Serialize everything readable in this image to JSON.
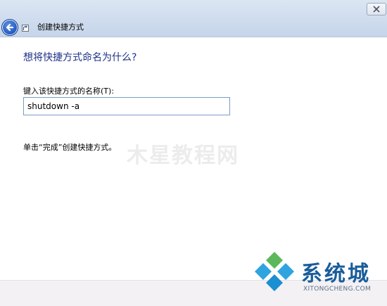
{
  "window": {
    "title": "创建快捷方式"
  },
  "main": {
    "heading": "想将快捷方式命名为什么?",
    "name_label": "键入该快捷方式的名称(T):",
    "name_value": "shutdown -a",
    "finish_hint": "单击“完成”创建快捷方式。"
  },
  "watermark": {
    "text": "木星教程网"
  },
  "logo": {
    "text": "系统城",
    "url": "XITONGCHENG.COM"
  },
  "colors": {
    "heading": "#1e3287",
    "titlebar": "#cfdcee",
    "logo_blue": "#1a5d9a",
    "logo_green": "#5cb85c",
    "logo_cyan": "#2fa4e0"
  },
  "icons": {
    "back": "back-arrow-icon",
    "close": "close-icon",
    "shortcut": "shortcut-arrow-icon",
    "logo": "diamond-logo-icon"
  }
}
